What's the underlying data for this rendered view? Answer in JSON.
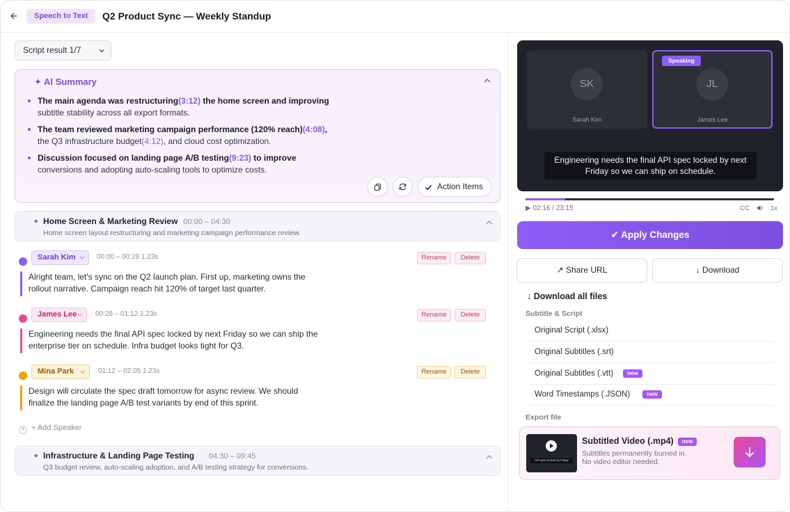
{
  "header": {
    "mode_pill": "Speech to Text",
    "title": "Q2 Product Sync — Weekly Standup"
  },
  "script_select": {
    "value": "Script result 1/7"
  },
  "summary": {
    "title": "AI Summary",
    "bullets": [
      {
        "b1": "The main agenda was restructuring",
        "t1": "(3:12)",
        "b2": " the home screen and improving",
        "rest": "subtitle stability across all export formats."
      },
      {
        "b1": "The team reviewed marketing campaign performance (120% reach)",
        "t1": "(4:08)",
        "b2": ",",
        "rest_a": "the Q3 infrastructure budget",
        "t2": "(4:12)",
        "rest_b": ", and cloud cost optimization."
      },
      {
        "b1": "Discussion focused on landing page A/B testing",
        "t1": "(9:23)",
        "b2": " to improve",
        "rest": "conversions and adopting auto-scaling tools to optimize costs."
      }
    ],
    "action_items_label": "Action Items"
  },
  "sections": [
    {
      "title": "Home Screen & Marketing Review",
      "time": "00:00 – 04:30",
      "desc": "Home screen layout restructuring and marketing campaign performance review."
    },
    {
      "title": "Infrastructure & Landing Page Testing",
      "time": "04:30 – 09:45",
      "desc": "Q3 budget review, auto-scaling adoption, and A/B testing strategy for conversions."
    }
  ],
  "speakers": [
    {
      "name": "Sarah Kim",
      "meta": "00:00 – 00:28 1.23s",
      "text": "Alright team, let's sync on the Q2 launch plan. First up, marketing owns the rollout narrative. Campaign reach hit 120% of target last quarter.",
      "color": "#8b5cf6"
    },
    {
      "name": "James Lee",
      "meta": "00:28 – 01:12 1.23s",
      "text": "Engineering needs the final API spec locked by next Friday so we can ship the enterprise tier on schedule. Infra budget looks tight for Q3.",
      "color": "#ec4899"
    },
    {
      "name": "Mina Park",
      "meta": "01:12 – 02:05 1.23s",
      "text": "Design will circulate the spec draft tomorrow for async review. We should finalize the landing page A/B test variants by end of this sprint.",
      "color": "#f59e0b"
    }
  ],
  "speaker_buttons": {
    "rename": "Rename",
    "delete": "Delete"
  },
  "add_speaker": "+ Add Speaker",
  "video": {
    "participants": [
      {
        "initials": "SK",
        "name": "Sarah Kim"
      },
      {
        "initials": "JL",
        "name": "James Lee"
      }
    ],
    "speaking_badge": "Speaking",
    "caption": "Engineering needs the final API spec locked by next Friday so we can ship on schedule.",
    "time": "02:16 / 23:15",
    "progress_fraction": 0.16,
    "cc": "CC",
    "speed": "1x"
  },
  "actions": {
    "apply": "✔ Apply Changes",
    "share": "↗ Share URL",
    "download": "↓ Download"
  },
  "downloads": {
    "title": "↓ Download all files",
    "subtitle_heading": "Subtitle & Script",
    "files": [
      {
        "label": "Original Script (.xlsx)",
        "badge": ""
      },
      {
        "label": "Original Subtitles (.srt)",
        "badge": ""
      },
      {
        "label": "Original Subtitles (.vtt)",
        "badge": "new"
      },
      {
        "label": "Word Timestamps (.JSON)",
        "badge": "new"
      }
    ],
    "export_heading": "Export file",
    "export": {
      "title": "Subtitled Video (.mp4)",
      "badge": "new",
      "desc1": "Subtitles permanently burned in.",
      "desc2": "No video editor needed.",
      "thumb_caption": "API spec locked by Friday"
    }
  }
}
